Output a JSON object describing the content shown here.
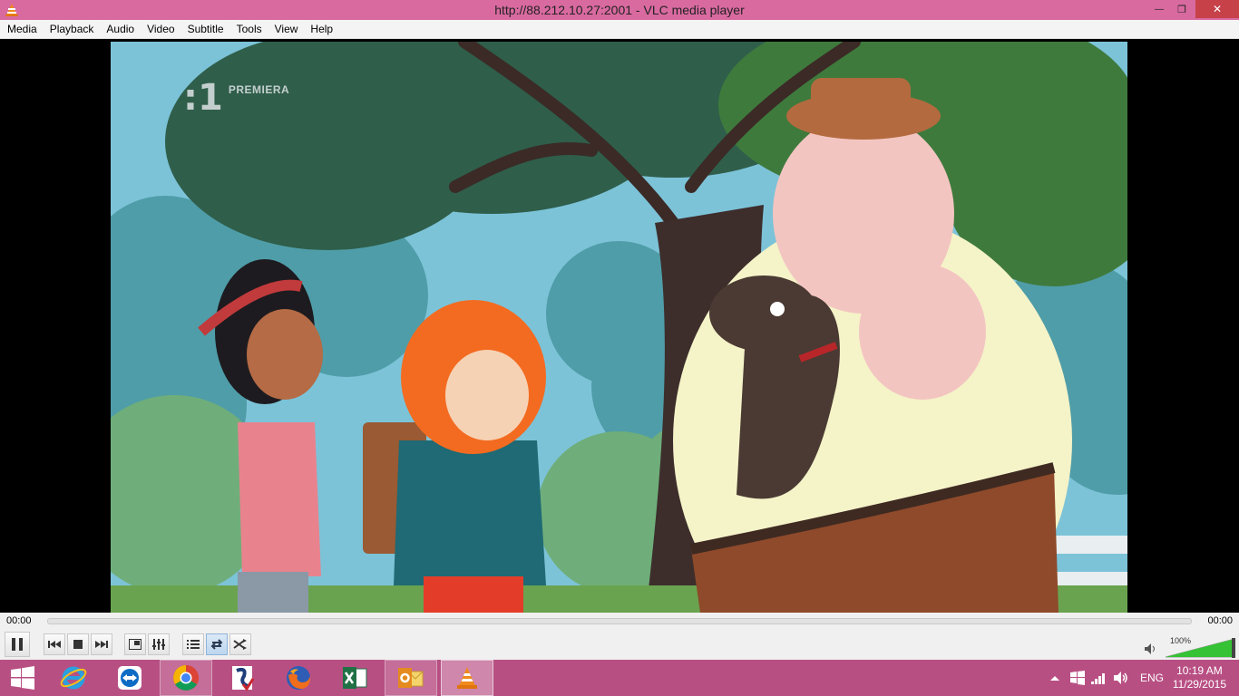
{
  "window": {
    "title": "http://88.212.10.27:2001 - VLC media player",
    "minimize_glyph": "—",
    "maximize_glyph": "❐",
    "close_glyph": "✕"
  },
  "menu": [
    "Media",
    "Playback",
    "Audio",
    "Video",
    "Subtitle",
    "Tools",
    "View",
    "Help"
  ],
  "video": {
    "channel_number": ":1",
    "channel_tag": "PREMIERA"
  },
  "playback": {
    "elapsed": "00:00",
    "total": "00:00",
    "progress": 0
  },
  "controls": {
    "buttons": [
      "pause-icon",
      "previous-icon",
      "stop-icon",
      "next-icon",
      "fullscreen-icon",
      "extended-settings-icon",
      "playlist-icon",
      "loop-icon",
      "random-icon"
    ],
    "loop_active": true,
    "volume_percent_label": "100%",
    "volume_level": 1.0
  },
  "taskbar": {
    "apps": [
      "windows-start-icon",
      "internet-explorer-icon",
      "teamviewer-icon",
      "chrome-icon",
      "sticky-app-icon",
      "firefox-icon",
      "excel-icon",
      "outlook-icon",
      "vlc-icon"
    ],
    "language": "ENG",
    "time": "10:19 AM",
    "date": "11/29/2015"
  },
  "colors": {
    "titlebar": "#d96aa0",
    "close_button": "#c74148",
    "taskbar": "#b84f83",
    "vlc_orange": "#f08a1c",
    "volume_green": "#35c235"
  }
}
